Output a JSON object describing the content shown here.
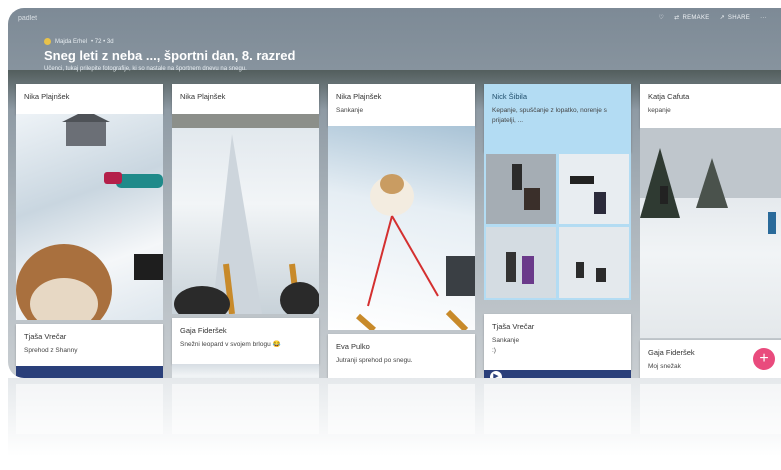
{
  "topbar": {
    "brand": "padlet",
    "actions": [
      {
        "icon": "heart-icon",
        "label": ""
      },
      {
        "icon": "remake-icon",
        "label": "REMAKE"
      },
      {
        "icon": "share-icon",
        "label": "SHARE"
      },
      {
        "icon": "more-icon",
        "label": "···"
      }
    ]
  },
  "header": {
    "author": "Majda Erhel",
    "meta": "• 72 • 3d",
    "title": "Sneg leti z neba ..., športni dan, 8. razred",
    "subtitle": "Učenci, tukaj prilepite fotografije, ki so nastale na športnem dnevu na snegu."
  },
  "columns": [
    {
      "cards": [
        {
          "author": "Nika Plajnšek",
          "text": ""
        },
        {
          "author": "Tjaša Vrečar",
          "text": "Sprehod z Shanny"
        }
      ]
    },
    {
      "cards": [
        {
          "author": "Nika Plajnšek",
          "text": ""
        },
        {
          "author": "Gaja Fideršek",
          "text": "Snežni leopard v svojem brlogu 😂"
        }
      ]
    },
    {
      "cards": [
        {
          "author": "Nika Plajnšek",
          "text": "Sankanje"
        },
        {
          "author": "Eva Pulko",
          "text": "Jutranji sprehod po snegu."
        }
      ]
    },
    {
      "cards": [
        {
          "author": "Nick Šibila",
          "text": "Kepanje, spuščanje z lopatko, norenje s prijatelji, ..."
        },
        {
          "author": "Tjaša Vrečar",
          "text": "Sankanje",
          "text2": ":)"
        }
      ]
    },
    {
      "cards": [
        {
          "author": "Katja Cafuta",
          "text": "kepanje"
        },
        {
          "author": "Gaja Fideršek",
          "text": "Moj snežak"
        }
      ]
    }
  ],
  "fab": {
    "label": "+"
  },
  "colors": {
    "accent": "#e94b7d",
    "highlight_card": "#b3dcf3",
    "dark_bar": "#2a3f7a"
  }
}
